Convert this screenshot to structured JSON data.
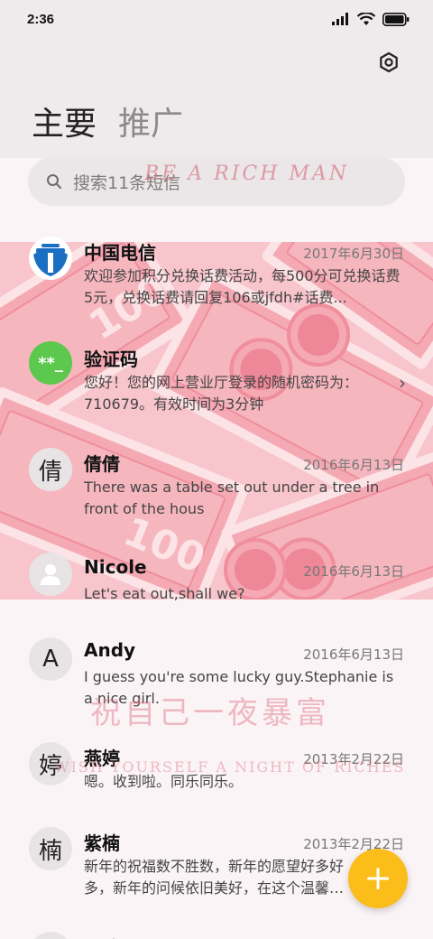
{
  "status_bar": {
    "time": "2:36"
  },
  "tabs": {
    "primary": "主要",
    "promotions": "推广"
  },
  "search": {
    "placeholder": "搜索11条短信"
  },
  "wallpaper_text": {
    "top": "BE A RICH MAN",
    "middle": "祝自己一夜暴富",
    "bottom": "WISH YOURSELF A NIGHT OF RICHES"
  },
  "conversations": [
    {
      "name": "中国电信",
      "date": "2017年6月30日",
      "preview": "欢迎参加积分兑换话费活动，每500分可兑换话费5元，兑换话费请回复106或jfdh#话费..."
    },
    {
      "name": "验证码",
      "avatar_text": "**_",
      "preview": "您好！您的网上营业厅登录的随机密码为：710679。有效时间为3分钟"
    },
    {
      "name": "倩倩",
      "avatar_text": "倩",
      "date": "2016年6月13日",
      "preview": "There was a table set out under a tree in front of the hous"
    },
    {
      "name": "Nicole",
      "date": "2016年6月13日",
      "preview": "Let's eat out,shall we?"
    },
    {
      "name": "Andy",
      "avatar_text": "A",
      "date": "2016年6月13日",
      "preview": "I guess you're some lucky guy.Stephanie is a nice girl."
    },
    {
      "name": "燕婷",
      "avatar_text": "婷",
      "date": "2013年2月22日",
      "preview": "嗯。收到啦。同乐同乐。"
    },
    {
      "name": "紫楠",
      "avatar_text": "楠",
      "date": "2013年2月22日",
      "preview": "新年的祝福数不胜数，新年的愿望好多好多，新年的问候依旧美好，在这个温馨的时刻"
    },
    {
      "name": "子玲"
    }
  ],
  "colors": {
    "fab": "#fbbd1a",
    "verify_avatar": "#5cc84e",
    "telecom_blue": "#1a6fc2"
  }
}
